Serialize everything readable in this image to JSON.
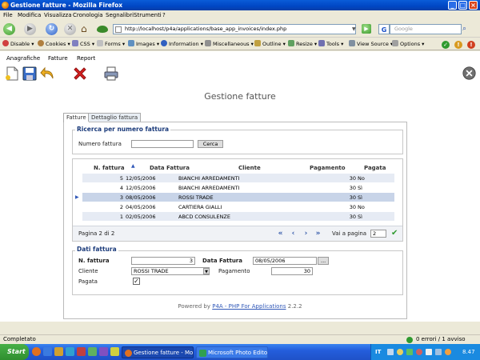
{
  "window": {
    "title": "Gestione fatture - Mozilla Firefox"
  },
  "menubar": [
    "File",
    "Modifica",
    "Visualizza",
    "Cronologia",
    "Segnalibri",
    "Strumenti",
    "?"
  ],
  "nav": {
    "url": "http://localhost/p4a/applications/base_app_invoices/index.php",
    "search_placeholder": "Google"
  },
  "devbar": [
    "Disable",
    "Cookies",
    "CSS",
    "Forms",
    "Images",
    "Information",
    "Miscellaneous",
    "Outline",
    "Resize",
    "Tools",
    "View Source",
    "Options"
  ],
  "app_menu": [
    "Anagrafiche",
    "Fatture",
    "Report"
  ],
  "page_title": "Gestione fatture",
  "tabs": [
    "Fatture",
    "Dettaglio fattura"
  ],
  "search": {
    "legend": "Ricerca per numero fattura",
    "label": "Numero fattura",
    "value": "",
    "button": "Cerca"
  },
  "grid": {
    "columns": [
      "N. fattura",
      "Data Fattura",
      "Cliente",
      "Pagamento",
      "Pagata"
    ],
    "rows": [
      {
        "n": "5",
        "data": "12/05/2006",
        "cliente": "BIANCHI ARREDAMENTI",
        "pagamento": "30",
        "pagata": "No"
      },
      {
        "n": "4",
        "data": "12/05/2006",
        "cliente": "BIANCHI ARREDAMENTI",
        "pagamento": "30",
        "pagata": "Sì"
      },
      {
        "n": "3",
        "data": "08/05/2006",
        "cliente": "ROSSI TRADE",
        "pagamento": "30",
        "pagata": "Sì"
      },
      {
        "n": "2",
        "data": "04/05/2006",
        "cliente": "CARTIERA GIALLI",
        "pagamento": "30",
        "pagata": "No"
      },
      {
        "n": "1",
        "data": "02/05/2006",
        "cliente": "ABCD CONSULENZE",
        "pagamento": "30",
        "pagata": "Sì"
      }
    ],
    "selected_row": 2,
    "pager_text": "Pagina 2 di 2",
    "goto_label": "Vai a pagina",
    "goto_value": "2"
  },
  "detail": {
    "legend": "Dati fattura",
    "n_label": "N. fattura",
    "n_value": "3",
    "data_label": "Data Fattura",
    "data_value": "08/05/2006",
    "data_button": "...",
    "cliente_label": "Cliente",
    "cliente_value": "ROSSI TRADE",
    "pagamento_label": "Pagamento",
    "pagamento_value": "30",
    "pagata_label": "Pagata",
    "pagata_checked": true
  },
  "footer": {
    "prefix": "Powered by ",
    "link": "P4A - PHP For Applications",
    "version": " 2.2.2"
  },
  "status": {
    "text": "Completato",
    "errors": "0 errori / 1 avviso"
  },
  "taskbar": {
    "start": "Start",
    "tasks": [
      "Gestione fatture - Mo...",
      "Microsoft Photo Editor"
    ],
    "clock": "8.47",
    "lang": "IT"
  }
}
